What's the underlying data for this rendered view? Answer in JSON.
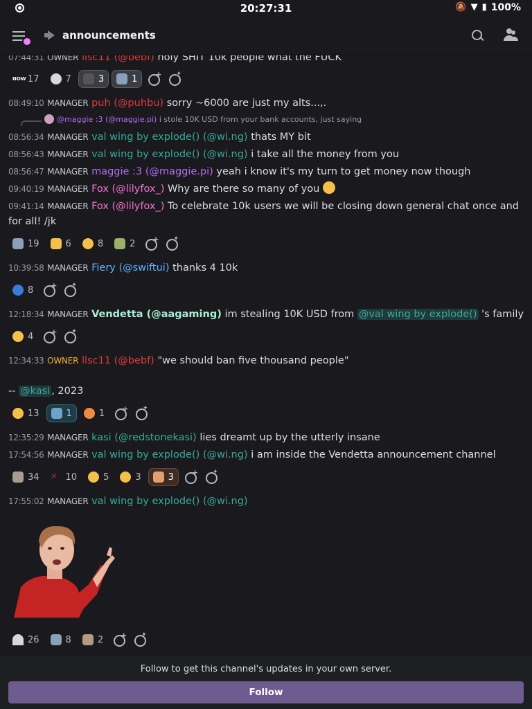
{
  "status_bar": {
    "time": "20:27:31",
    "battery": "100%"
  },
  "header": {
    "channel": "announcements"
  },
  "messages": [
    {
      "ts": "07:44:31",
      "role": "OWNER",
      "author": "llsc11 (@bebf)",
      "text": "holy SHIT 10k people what the FUCK"
    },
    {
      "ts": "08:49:10",
      "role": "MANAGER",
      "author": "puh (@puhbu)",
      "text": "sorry ~6000 are just my alts...,."
    },
    {
      "ts": "08:56:34",
      "role": "MANAGER",
      "author": "val wing by explode() (@wi.ng)",
      "text": "thats MY bit"
    },
    {
      "ts": "08:56:43",
      "role": "MANAGER",
      "author": "val wing by explode() (@wi.ng)",
      "text": "i take all the money from you"
    },
    {
      "ts": "08:56:47",
      "role": "MANAGER",
      "author": "maggie :3 (@maggie.pi)",
      "text": "yeah i know it's my turn to get money now though"
    },
    {
      "ts": "09:40:19",
      "role": "MANAGER",
      "author": "Fox (@lilyfox_)",
      "text": "Why are there so many of you"
    },
    {
      "ts": "09:41:14",
      "role": "MANAGER",
      "author": "Fox (@lilyfox_)",
      "text": "To celebrate 10k users we will be closing down general chat once and for all! /jk"
    },
    {
      "ts": "10:39:58",
      "role": "MANAGER",
      "author": "Fiery (@swiftui)",
      "text": "thanks 4 10k"
    },
    {
      "ts": "12:18:34",
      "role": "MANAGER",
      "author": "Vendetta (@aagaming)",
      "text_before": "im stealing 10K USD from",
      "mention": "@val wing by explode()",
      "text_after": "'s family"
    },
    {
      "ts": "12:34:33",
      "role": "OWNER",
      "author": "llsc11 (@bebf)",
      "text": "\"we should ban five thousand people\""
    },
    {
      "quote_prefix": "--",
      "mention": "@kasi",
      "quote_suffix": ", 2023"
    },
    {
      "ts": "12:35:29",
      "role": "MANAGER",
      "author": "kasi (@redstonekasi)",
      "text": "lies dreamt up by the utterly insane"
    },
    {
      "ts": "17:54:56",
      "role": "MANAGER",
      "author": "val wing by explode() (@wi.ng)",
      "text": "i am inside the Vendetta announcement channel"
    },
    {
      "ts": "17:55:02",
      "role": "MANAGER",
      "author": "val wing by explode() (@wi.ng)",
      "text": ""
    }
  ],
  "reply": {
    "author": "@maggie :3 (@maggie.pi)",
    "text": "i stole 10K USD from your bank accounts, just saying"
  },
  "reactions": {
    "r1": [
      "17",
      "7",
      "3",
      "1"
    ],
    "r2": [
      "19",
      "6",
      "8",
      "2"
    ],
    "r3": [
      "8"
    ],
    "r4": [
      "4"
    ],
    "r5": [
      "13",
      "1",
      "1"
    ],
    "r6": [
      "34",
      "10",
      "5",
      "3",
      "3"
    ],
    "r7": [
      "26",
      "8",
      "2"
    ]
  },
  "follow": {
    "text": "Follow to get this channel's updates in your own server.",
    "button": "Follow"
  },
  "colors": {
    "accent": "#6e5b8f",
    "background": "#1a1a1e",
    "owner_role": "#f0b232"
  }
}
